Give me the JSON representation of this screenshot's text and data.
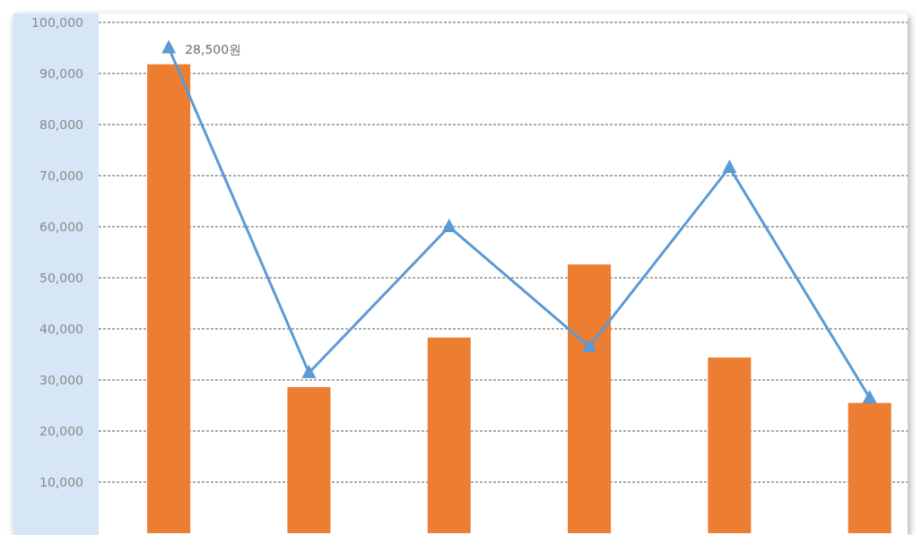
{
  "chart": {
    "chart_data": {
      "type": "bar",
      "stacked": false,
      "grid": true,
      "ylim": [
        0,
        100000
      ],
      "yticks": [
        {
          "value": 10000,
          "label": "10,000"
        },
        {
          "value": 20000,
          "label": "20,000"
        },
        {
          "value": 30000,
          "label": "30,000"
        },
        {
          "value": 40000,
          "label": "40,000"
        },
        {
          "value": 50000,
          "label": "50,000"
        },
        {
          "value": 60000,
          "label": "60,000"
        },
        {
          "value": 70000,
          "label": "70,000"
        },
        {
          "value": 80000,
          "label": "80,000"
        },
        {
          "value": 90000,
          "label": "90,000"
        },
        {
          "value": 100000,
          "label": "100,000"
        }
      ],
      "series": [
        {
          "color": "#ed7d31",
          "values": [
            91800,
            28600,
            38300,
            52600,
            34400,
            25500
          ]
        },
        {
          "type": "line",
          "marker": "triangle",
          "color": "#5b9bd5",
          "values": [
            95000,
            31400,
            60000,
            36500,
            71600,
            26500
          ]
        }
      ],
      "annotations": [
        "28,500원"
      ]
    }
  }
}
